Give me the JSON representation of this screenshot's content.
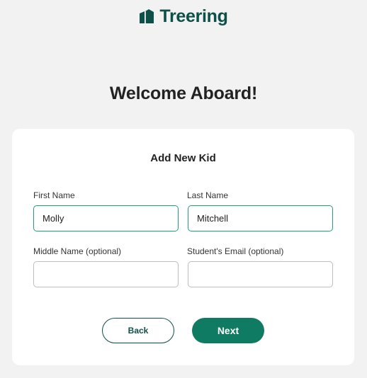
{
  "brand": {
    "name": "Treering",
    "logo_icon": "treering-logo-icon",
    "color": "#0d4f49"
  },
  "heading": "Welcome Aboard!",
  "form": {
    "title": "Add New Kid",
    "fields": {
      "first_name": {
        "label": "First Name",
        "value": "Molly"
      },
      "last_name": {
        "label": "Last Name",
        "value": "Mitchell"
      },
      "middle_name": {
        "label": "Middle Name (optional)",
        "value": ""
      },
      "student_email": {
        "label": "Student's Email (optional)",
        "value": ""
      }
    },
    "focus_border_color": "#1f9e78"
  },
  "buttons": {
    "back": "Back",
    "next": "Next",
    "primary_color": "#0e7b62"
  }
}
